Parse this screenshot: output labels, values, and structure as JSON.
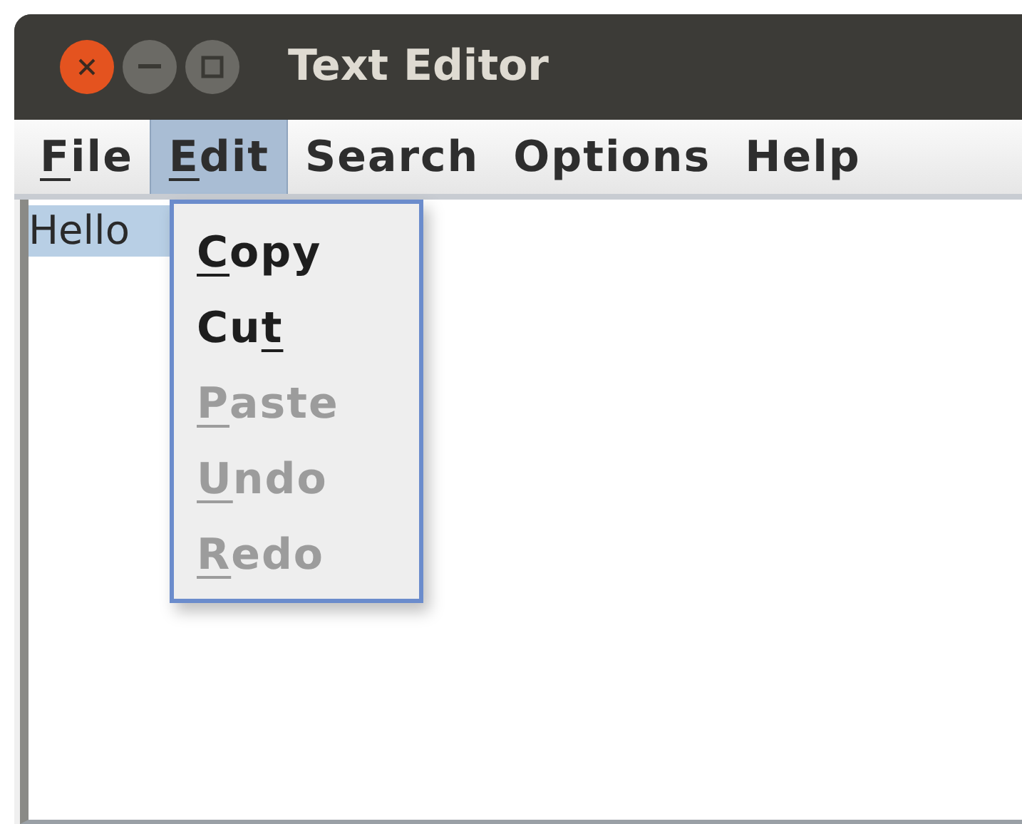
{
  "window": {
    "title": "Text Editor"
  },
  "menu_bar": [
    {
      "parts": [
        {
          "text": "F",
          "underlined": true
        },
        {
          "text": "ile",
          "underlined": false
        }
      ],
      "selected": false
    },
    {
      "parts": [
        {
          "text": "E",
          "underlined": true
        },
        {
          "text": "dit",
          "underlined": false
        }
      ],
      "selected": true
    },
    {
      "parts": [
        {
          "text": "Search",
          "underlined": false
        }
      ],
      "selected": false
    },
    {
      "parts": [
        {
          "text": "Options",
          "underlined": false
        }
      ],
      "selected": false
    },
    {
      "parts": [
        {
          "text": "Help",
          "underlined": false
        }
      ],
      "selected": false
    }
  ],
  "editor": {
    "text": "Hello",
    "selected": true
  },
  "edit_menu": [
    {
      "parts": [
        {
          "text": "C",
          "underlined": true
        },
        {
          "text": "opy",
          "underlined": false
        }
      ],
      "disabled": false
    },
    {
      "parts": [
        {
          "text": "Cu",
          "underlined": false
        },
        {
          "text": "t",
          "underlined": true
        }
      ],
      "disabled": false
    },
    {
      "parts": [
        {
          "text": "P",
          "underlined": true
        },
        {
          "text": "aste",
          "underlined": false
        }
      ],
      "disabled": true
    },
    {
      "parts": [
        {
          "text": "U",
          "underlined": true
        },
        {
          "text": "ndo",
          "underlined": false
        }
      ],
      "disabled": true
    },
    {
      "parts": [
        {
          "text": "R",
          "underlined": true
        },
        {
          "text": "edo",
          "underlined": false
        }
      ],
      "disabled": true
    }
  ]
}
